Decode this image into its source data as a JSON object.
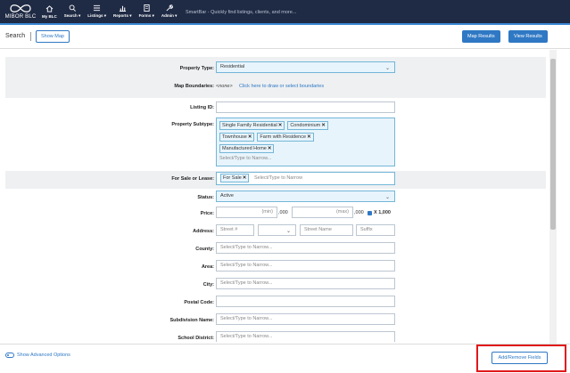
{
  "nav": {
    "logo_text": "MIBOR BLC",
    "items": [
      {
        "label": "My BLC",
        "icon": "home-icon"
      },
      {
        "label": "Search ▾",
        "icon": "search-icon"
      },
      {
        "label": "Listings ▾",
        "icon": "list-icon"
      },
      {
        "label": "Reports ▾",
        "icon": "bar-chart-icon"
      },
      {
        "label": "Forms ▾",
        "icon": "document-icon"
      },
      {
        "label": "Admin ▾",
        "icon": "wrench-icon"
      }
    ],
    "smartbar_placeholder": "SmartBar - Quickly find listings, clients, and more..."
  },
  "header": {
    "title": "Search",
    "show_map": "Show Map",
    "map_results": "Map Results",
    "view_results": "View Results"
  },
  "form": {
    "property_type": {
      "label": "Property Type:",
      "value": "Residential"
    },
    "map_boundaries": {
      "label": "Map Boundaries:",
      "none": "<none>",
      "link": "Click here to draw or select boundaries"
    },
    "listing_id": {
      "label": "Listing ID:"
    },
    "property_subtype": {
      "label": "Property Subtype:",
      "tags": [
        "Single Family Residential",
        "Condominium",
        "Townhouse",
        "Farm with Residence",
        "Manufactured Home"
      ],
      "placeholder": "Select/Type to Narrow..."
    },
    "for_sale_or_lease": {
      "label": "For Sale or Lease:",
      "tag": "For Sale",
      "placeholder": "Select/Type to Narrow"
    },
    "status": {
      "label": "Status:",
      "value": "Active"
    },
    "price": {
      "label": "Price:",
      "min": "(min)",
      "max": "(max)",
      "thousands": ",000",
      "multiplier": "X 1,000"
    },
    "address": {
      "label": "Address:",
      "street_num": "Street #",
      "street_name": "Street Name",
      "suffix": "Suffix"
    },
    "county": {
      "label": "County:",
      "placeholder": "Select/Type to Narrow..."
    },
    "area": {
      "label": "Area:",
      "placeholder": "Select/Type to Narrow..."
    },
    "city": {
      "label": "City:",
      "placeholder": "Select/Type to Narrow..."
    },
    "postal_code": {
      "label": "Postal Code:"
    },
    "subdivision": {
      "label": "Subdivision Name:",
      "placeholder": "Select/Type to Narrow..."
    },
    "school_district": {
      "label": "School District:",
      "placeholder": "Select/Type to Narrow..."
    }
  },
  "footer": {
    "advanced": "Show Advanced Options",
    "add_remove": "Add/Remove Fields"
  },
  "colors": {
    "nav_bg": "#1f2a44",
    "accent": "#2f78c4",
    "highlight": "#e0181b"
  }
}
